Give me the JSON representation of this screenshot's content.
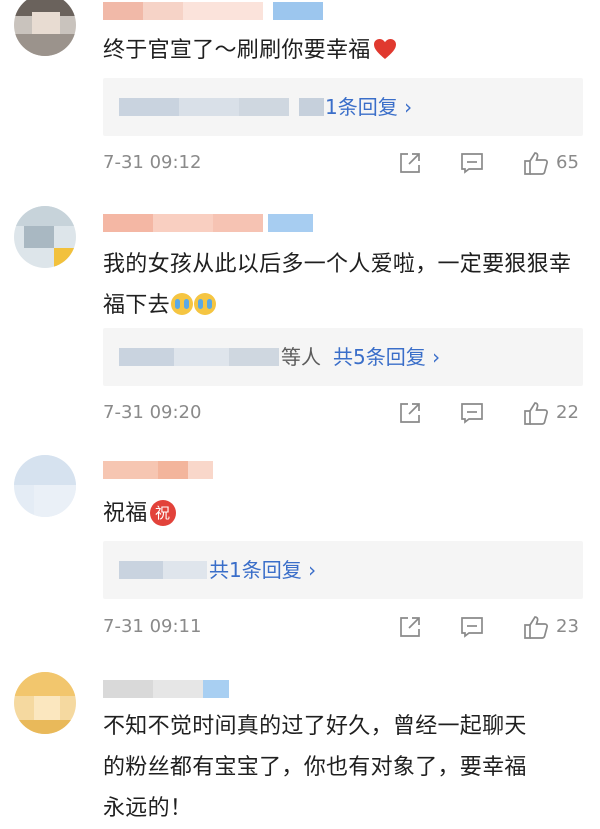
{
  "comments": [
    {
      "text": "终于官宣了～刷刷你要幸福",
      "reply_label": "1条回复 ›",
      "reply_prefix": "",
      "time": "7-31 09:12",
      "likes": "65"
    },
    {
      "text": "我的女孩从此以后多一个人爱啦，一定要狠狠幸福下去",
      "reply_prefix": "等人",
      "reply_label": "共5条回复 ›",
      "time": "7-31 09:20",
      "likes": "22"
    },
    {
      "text": "祝福",
      "emoji_label": "祝",
      "reply_prefix": "",
      "reply_label": "共1条回复 ›",
      "time": "7-31 09:11",
      "likes": "23"
    },
    {
      "text_lines": [
        "不知不觉时间真的过了好久，曾经一起聊天",
        "的粉丝都有宝宝了，你也有对象了，要幸福",
        "永远的！"
      ]
    }
  ],
  "icons": {
    "share": "share-icon",
    "comment": "comment-icon",
    "like": "thumbs-up-icon",
    "heart": "heart-emoji",
    "cry": "crying-emoji"
  },
  "colors": {
    "link": "#3a6ec9",
    "meta": "#8a8a8a",
    "reply_bg": "#f5f5f5"
  }
}
